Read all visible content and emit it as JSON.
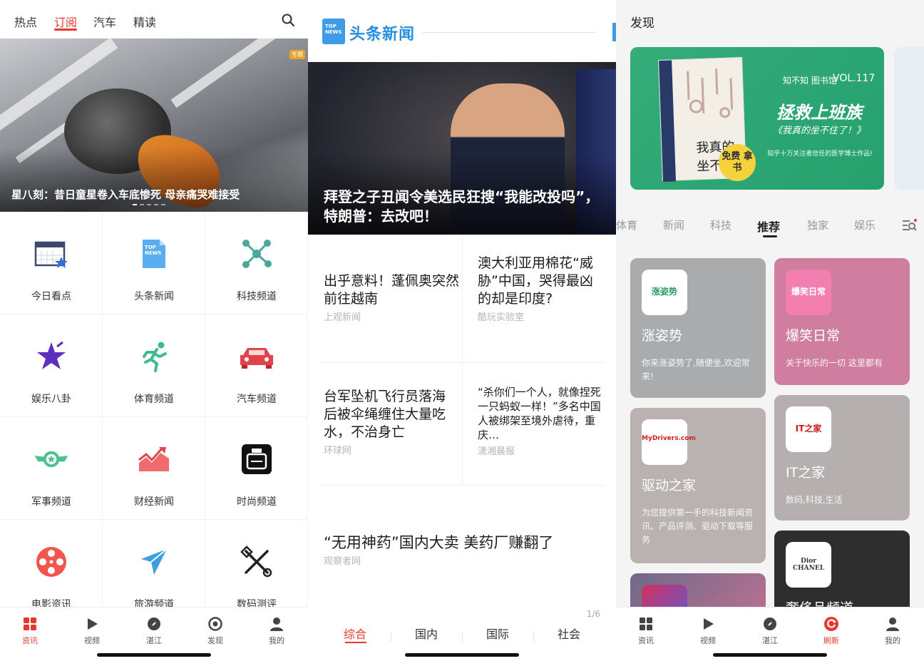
{
  "panel1": {
    "top_tabs": [
      "热点",
      "订阅",
      "汽车",
      "精读"
    ],
    "active_tab": "订阅",
    "hero": {
      "badge": "专题",
      "caption": "星八刻：昔日童星卷入车底惨死 母亲痛哭难接受"
    },
    "channels": [
      {
        "label": "今日看点",
        "icon": "calendar-star-icon"
      },
      {
        "label": "头条新闻",
        "icon": "top-news-icon"
      },
      {
        "label": "科技频道",
        "icon": "molecule-icon"
      },
      {
        "label": "娱乐八卦",
        "icon": "star-icon"
      },
      {
        "label": "体育频道",
        "icon": "runner-icon"
      },
      {
        "label": "汽车频道",
        "icon": "car-icon"
      },
      {
        "label": "军事频道",
        "icon": "military-badge-icon"
      },
      {
        "label": "财经新闻",
        "icon": "chart-icon"
      },
      {
        "label": "时尚频道",
        "icon": "perfume-icon"
      },
      {
        "label": "电影资讯",
        "icon": "film-reel-icon"
      },
      {
        "label": "旅游频道",
        "icon": "airplane-icon"
      },
      {
        "label": "数码测评",
        "icon": "tools-icon"
      }
    ],
    "bottom_tabs": [
      "资讯",
      "视频",
      "湛江",
      "发现",
      "我的"
    ],
    "active_bottom": "资讯"
  },
  "panel2": {
    "logo_text": "TOP NEWS",
    "title": "头条新闻",
    "hero_title": "拜登之子丑闻令美选民狂搜“我能改投吗”，特朗普：去改吧！",
    "cards": [
      {
        "title": "出乎意料！蓬佩奥突然前往越南",
        "source": "上观新闻"
      },
      {
        "title": "澳大利亚用棉花“威胁”中国，哭得最凶的却是印度?",
        "source": "酷玩实验室"
      },
      {
        "title": "台军坠机飞行员落海后被伞绳缠住大量吃水，不治身亡",
        "source": "环球网"
      },
      {
        "title": "“杀你们一个人，就像捏死一只蚂蚁一样！”多名中国人被绑架至境外虐待，重庆…",
        "source": "潇湘晨报"
      }
    ],
    "wide": {
      "title": "“无用神药”国内大卖 美药厂赚翻了",
      "source": "观察者网"
    },
    "page_indicator": "1/6",
    "tabs": [
      "综合",
      "国内",
      "国际",
      "社会"
    ],
    "active_tab": "综合"
  },
  "panel3": {
    "title": "发现",
    "banner": {
      "brand": "知不知 图书馆",
      "vol": "VOL.117",
      "headline": "拯救上班族",
      "sub": "《我真的坐不住了！》",
      "note": "知乎十万关注者信任的医学博士作品!",
      "book_text": "我真的坐不",
      "sticker": "免费 拿书"
    },
    "categories": [
      "体育",
      "新闻",
      "科技",
      "推荐",
      "独家",
      "娱乐"
    ],
    "active_category": "推荐",
    "cards": [
      {
        "name": "涨姿势",
        "logo": "涨姿势",
        "desc": "你来涨姿势了,随便坐,欢迎常来!",
        "color": "#a9abad"
      },
      {
        "name": "爆笑日常",
        "logo": "爆笑日常",
        "desc": "关于快乐的一切 这里都有",
        "color": "#cf7ea0"
      },
      {
        "name": "驱动之家",
        "logo": "MyDrivers.com",
        "desc": "为您提供第一手的科技新闻资讯、产品评测、驱动下载等服务",
        "color": "#b9b2b1"
      },
      {
        "name": "IT之家",
        "logo": "IT之家",
        "desc": "数码,科技,生活",
        "color": "#b5afb0"
      },
      {
        "name": "",
        "logo": "",
        "desc": "",
        "color": "#6e6a8a"
      },
      {
        "name": "奢侈品频道",
        "logo": "Dior CHANEL",
        "desc": "",
        "color": "#2e2e2e"
      }
    ],
    "bottom_tabs": [
      "资讯",
      "视频",
      "湛江",
      "刷新",
      "我的"
    ],
    "active_bottom": "刷新"
  },
  "colors": {
    "accent": "#e5392f",
    "brand_blue": "#2a8ee0"
  }
}
